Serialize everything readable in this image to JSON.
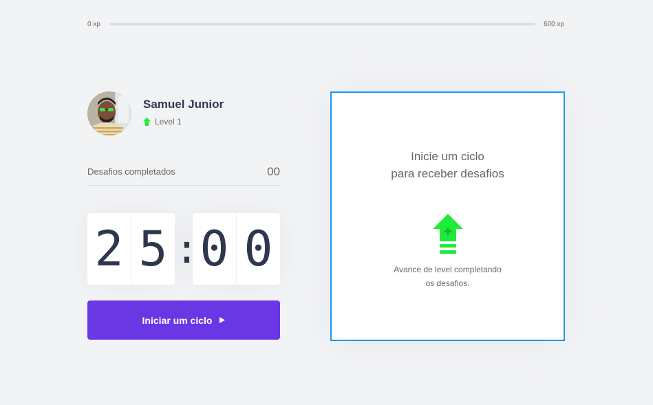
{
  "xp": {
    "min_label": "0 xp",
    "max_label": "600 xp",
    "current": 0,
    "max": 600,
    "fill_color": "#4cd62b",
    "track_color": "#dcdde0"
  },
  "profile": {
    "name": "Samuel Junior",
    "level_label": "Level 1",
    "level_icon": "level-up-arrow-icon",
    "avatar": "user-avatar-photo"
  },
  "completed_challenges": {
    "label": "Desafios completados",
    "count": "00"
  },
  "countdown": {
    "minute_left": "2",
    "minute_right": "5",
    "separator": ":",
    "second_left": "0",
    "second_right": "0"
  },
  "start_button": {
    "label": "Iniciar um ciclo",
    "icon": "play-icon",
    "color": "#6a37e4"
  },
  "challenge_box": {
    "title_line1": "Inicie um ciclo",
    "title_line2": "para receber desafios",
    "icon": "level-up-arrow-icon",
    "desc_line1": "Avance de level completando",
    "desc_line2": "os desafios.",
    "border_color": "#1a98ef",
    "icon_color": "#1ded3a"
  }
}
